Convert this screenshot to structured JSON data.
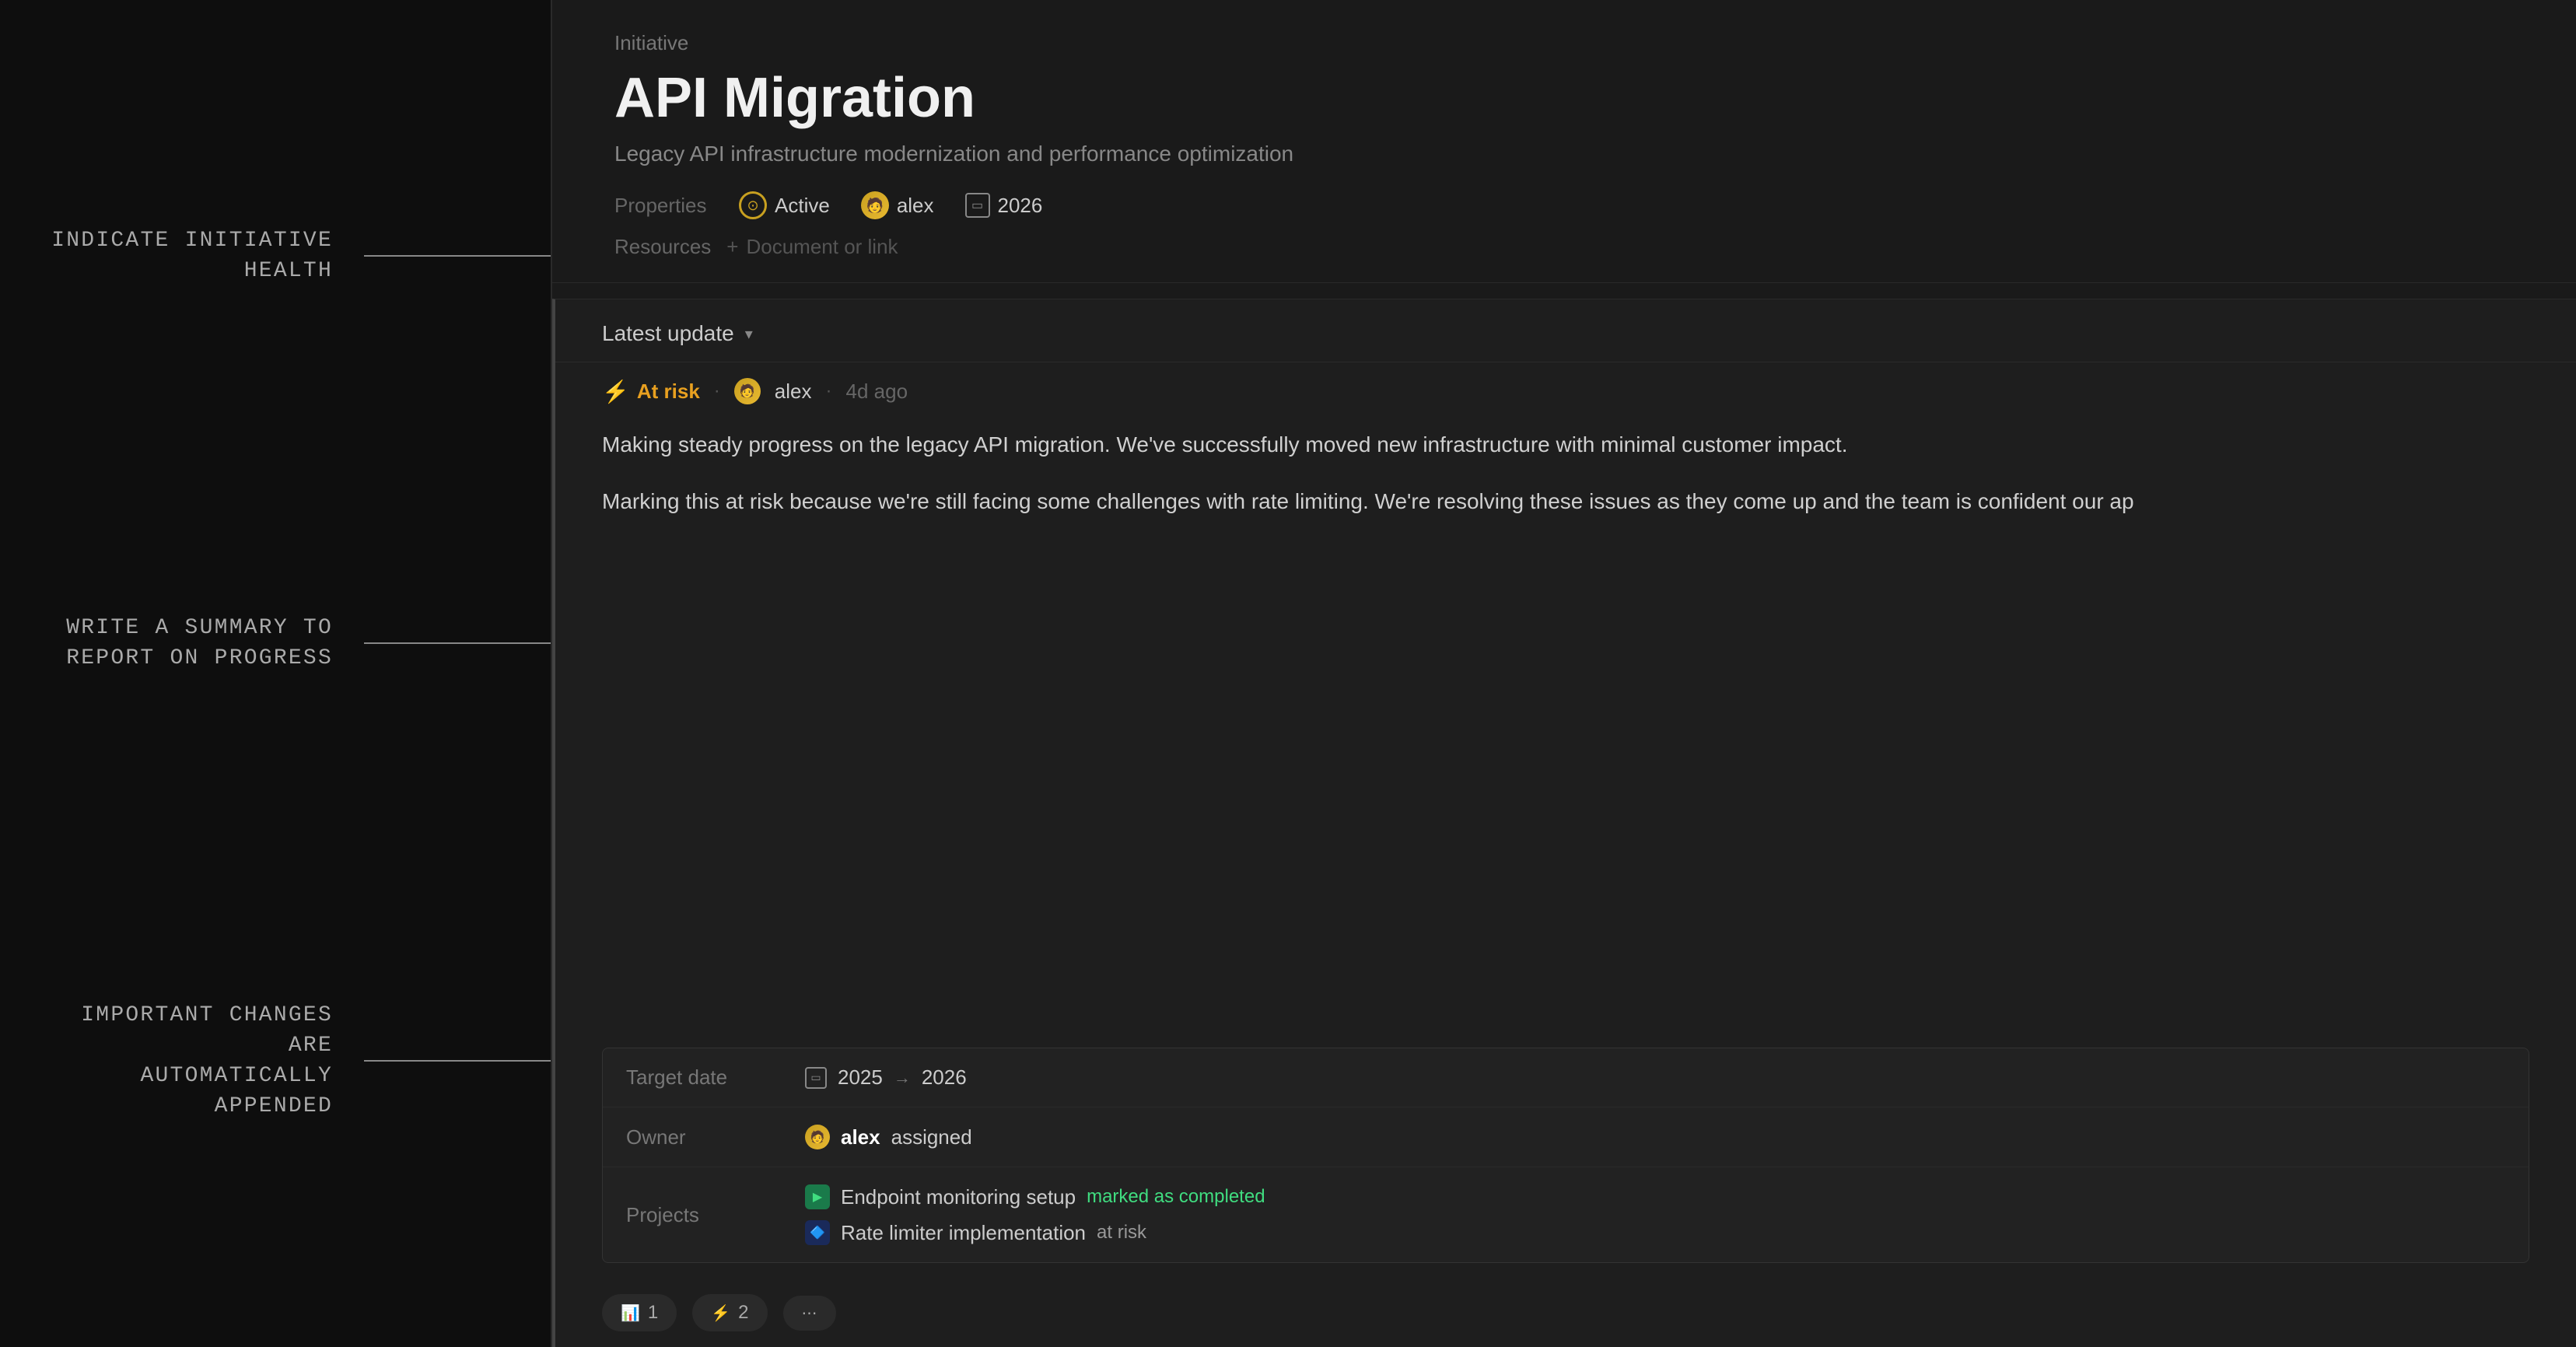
{
  "leftPanel": {
    "annotations": [
      {
        "id": "health",
        "text": "INDICATE INITIATIVE HEALTH"
      },
      {
        "id": "summary",
        "text": "WRITE A SUMMARY TO\nREPORT ON PROGRESS"
      },
      {
        "id": "changes",
        "text": "IMPORTANT CHANGES ARE\nAUTOMATICALLY APPENDED"
      }
    ]
  },
  "header": {
    "breadcrumb": "Initiative",
    "title": "API Migration",
    "subtitle": "Legacy API infrastructure modernization and performance optimization"
  },
  "properties": {
    "label": "Properties",
    "status": "Active",
    "owner": "alex",
    "year": "2026"
  },
  "resources": {
    "label": "Resources",
    "addPlaceholder": "Document or link"
  },
  "latestUpdate": {
    "label": "Latest update",
    "riskStatus": "At risk",
    "author": "alex",
    "timeAgo": "4d ago",
    "paragraph1": "Making steady progress on the legacy API migration. We've successfully moved new infrastructure with minimal customer impact.",
    "paragraph2": "Marking this at risk because we're still facing some challenges with rate limiting. We're resolving these issues as they come up and the team is confident our ap"
  },
  "metadata": {
    "targetDate": {
      "key": "Target date",
      "from": "2025",
      "to": "2026"
    },
    "owner": {
      "key": "Owner",
      "name": "alex",
      "suffix": "assigned"
    },
    "projects": {
      "key": "Projects",
      "items": [
        {
          "name": "Endpoint monitoring setup",
          "status": "marked as completed",
          "statusType": "completed"
        },
        {
          "name": "Rate limiter implementation",
          "status": "at risk",
          "statusType": "risk"
        }
      ]
    }
  },
  "bottomBadges": [
    {
      "icon": "📊",
      "label": "1",
      "type": "default"
    },
    {
      "icon": "⚡",
      "label": "2",
      "type": "risk"
    },
    {
      "icon": "⋯",
      "label": "",
      "type": "default"
    }
  ]
}
